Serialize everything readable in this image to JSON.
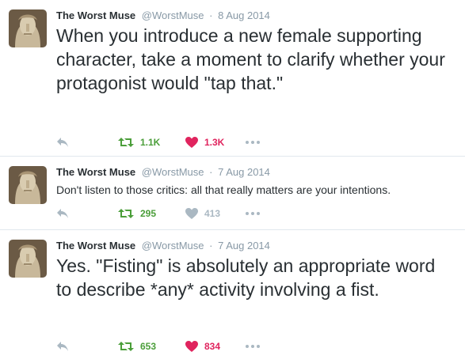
{
  "tweets": [
    {
      "name": "The Worst Muse",
      "handle": "@WorstMuse",
      "separator": "·",
      "date": "8 Aug 2014",
      "text": "When you introduce a new female supporting character, take a moment to clarify whether your protagonist would \"tap that.\"",
      "retweets": "1.1K",
      "likes": "1.3K",
      "liked": true
    },
    {
      "name": "The Worst Muse",
      "handle": "@WorstMuse",
      "separator": "·",
      "date": "7 Aug 2014",
      "text": "Don't listen to those critics: all that really matters are your intentions.",
      "retweets": "295",
      "likes": "413",
      "liked": false
    },
    {
      "name": "The Worst Muse",
      "handle": "@WorstMuse",
      "separator": "·",
      "date": "7 Aug 2014",
      "text": "Yes. \"Fisting\" is absolutely an appropriate word to describe *any* activity involving a fist.",
      "retweets": "653",
      "likes": "834",
      "liked": true
    }
  ],
  "icons": {
    "reply": "reply-icon",
    "retweet": "retweet-icon",
    "like": "heart-icon",
    "more": "more-icon"
  },
  "colors": {
    "retweet_green": "#4b9e3a",
    "like_red": "#e0245e",
    "muted_grey": "#aab8c2",
    "border": "#e1e8ed"
  }
}
